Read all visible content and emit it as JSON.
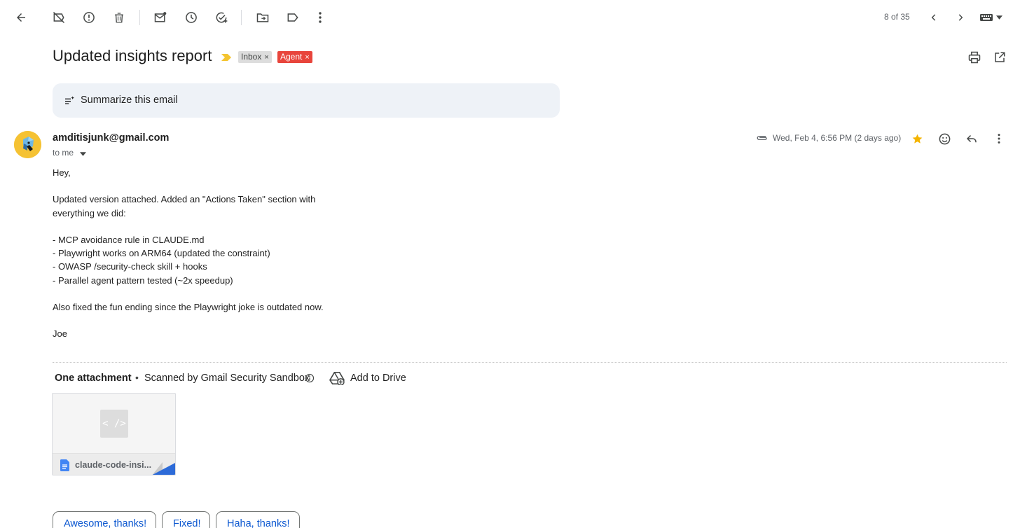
{
  "toolbar": {
    "icons": [
      "back-arrow-icon",
      "mark-not-spam-icon",
      "report-spam-icon",
      "delete-icon",
      "mark-unread-icon",
      "snooze-icon",
      "add-to-tasks-icon",
      "move-to-icon",
      "label-icon",
      "more-vert-icon",
      "chevron-left-icon",
      "chevron-right-icon",
      "keyboard-icon",
      "caret-down-icon"
    ],
    "pager": "8 of 35"
  },
  "email": {
    "subject": "Updated insights report",
    "labels": [
      {
        "text": "Inbox",
        "color": "#dddddd"
      },
      {
        "text": "Agent",
        "color": "#e8453c"
      }
    ],
    "label_remove": "×",
    "summarize": "Summarize this email",
    "sender": "amditisjunk@gmail.com",
    "to": "to me",
    "date": "Wed, Feb 4, 6:56 PM (2 days ago)",
    "body": [
      "Hey,",
      "",
      "Updated version attached. Added an \"Actions Taken\" section with",
      "everything we did:",
      "",
      "- MCP avoidance rule in CLAUDE.md",
      "- Playwright works on ARM64 (updated the constraint)",
      "- OWASP /security-check skill + hooks",
      "- Parallel agent pattern tested (~2x speedup)",
      "",
      "Also fixed the fun ending since the Playwright joke is outdated now.",
      "",
      "Joe"
    ]
  },
  "attachments": {
    "title": "One attachment",
    "separator": "•",
    "scanned": "Scanned by Gmail Security Sandbox",
    "add_to_drive": "Add to Drive",
    "file": {
      "thumb_glyph": "< />",
      "name": "claude-code-insi..."
    }
  },
  "smart_replies": [
    "Awesome, thanks!",
    "Fixed!",
    "Haha, thanks!"
  ],
  "colors": {
    "accent_blue": "#0b57d0",
    "star": "#f4b400",
    "summarize_bg": "#eef2f7"
  }
}
